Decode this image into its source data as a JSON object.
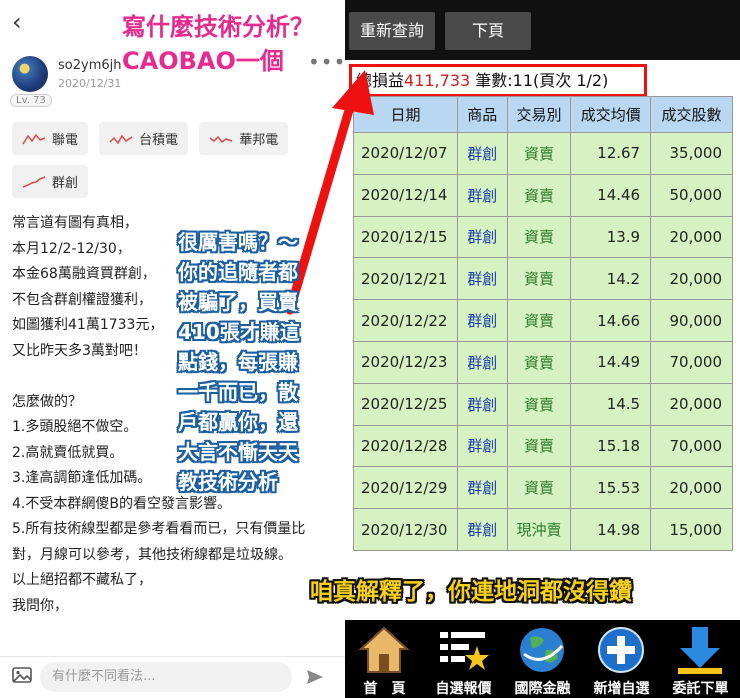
{
  "post": {
    "username": "so2ym6jh",
    "date": "2020/12/31",
    "level": "Lv. 73",
    "more_icon": "ellipsis-icon",
    "tags": [
      "聯電",
      "台積電",
      "華邦電",
      "群創"
    ],
    "body_lines": [
      "常言道有圖有真相，",
      "本月12/2-12/30，",
      "本金68萬融資買群創，",
      "不包含群創權證獲利，",
      "如圖獲利41萬1733元，",
      "又比昨天多3萬對吧！",
      "",
      "怎麼做的？",
      "1.多頭股絕不做空。",
      "2.高就賣低就買。",
      "3.逢高調節逢低加碼。",
      "4.不受本群網傻B的看空發言影響。",
      "5.所有技術線型都是參考看看而已，只有價量比",
      "對，月線可以參考，其他技術線都是垃圾線。",
      "以上絕招都不藏私了，",
      "我問你，"
    ],
    "comment_placeholder": "有什麼不同看法..."
  },
  "app": {
    "requery_label": "重新查詢",
    "next_label": "下頁",
    "summary_prefix": "總損益",
    "summary_pnl": "411,733",
    "summary_suffix": " 筆數:11(頁次 1/2)",
    "columns": [
      "日期",
      "商品",
      "交易別",
      "成交均價",
      "成交股數"
    ],
    "rows": [
      [
        "2020/12/07",
        "群創",
        "資賣",
        "12.67",
        "35,000"
      ],
      [
        "2020/12/14",
        "群創",
        "資賣",
        "14.46",
        "50,000"
      ],
      [
        "2020/12/15",
        "群創",
        "資賣",
        "13.9",
        "20,000"
      ],
      [
        "2020/12/21",
        "群創",
        "資賣",
        "14.2",
        "20,000"
      ],
      [
        "2020/12/22",
        "群創",
        "資賣",
        "14.66",
        "90,000"
      ],
      [
        "2020/12/23",
        "群創",
        "資賣",
        "14.49",
        "70,000"
      ],
      [
        "2020/12/25",
        "群創",
        "資賣",
        "14.5",
        "20,000"
      ],
      [
        "2020/12/28",
        "群創",
        "資賣",
        "15.18",
        "70,000"
      ],
      [
        "2020/12/29",
        "群創",
        "資賣",
        "15.53",
        "20,000"
      ],
      [
        "2020/12/30",
        "群創",
        "現沖賣",
        "14.98",
        "15,000"
      ]
    ],
    "nav": [
      {
        "label": "首　頁",
        "icon": "home-icon"
      },
      {
        "label": "自選報價",
        "icon": "list-star-icon"
      },
      {
        "label": "國際金融",
        "icon": "globe-icon"
      },
      {
        "label": "新增自選",
        "icon": "plus-icon"
      },
      {
        "label": "委託下單",
        "icon": "download-arrow-icon"
      }
    ]
  },
  "overlays": {
    "top_caption_line1": "寫什麼技術分析？",
    "top_caption_line2": "CAOBAO一個",
    "middle_caption": [
      "很厲害嗎？～",
      "你的追隨者都",
      "被騙了，買賣",
      "410張才賺這",
      "點錢，每張賺",
      "一千而已，散",
      "戶都贏你，還",
      "大言不慚天天",
      "教技術分析"
    ],
    "bottom_caption": "咱真解釋了，你連地洞都沒得鑽"
  },
  "colors": {
    "pnl_red": "#d21d1d",
    "highlight_red": "#ee1111",
    "header_blue": "#b9d7f1",
    "row_green": "#d6f2c2",
    "caption_pink": "#e62a8f",
    "caption_yellow": "#f6d019"
  }
}
